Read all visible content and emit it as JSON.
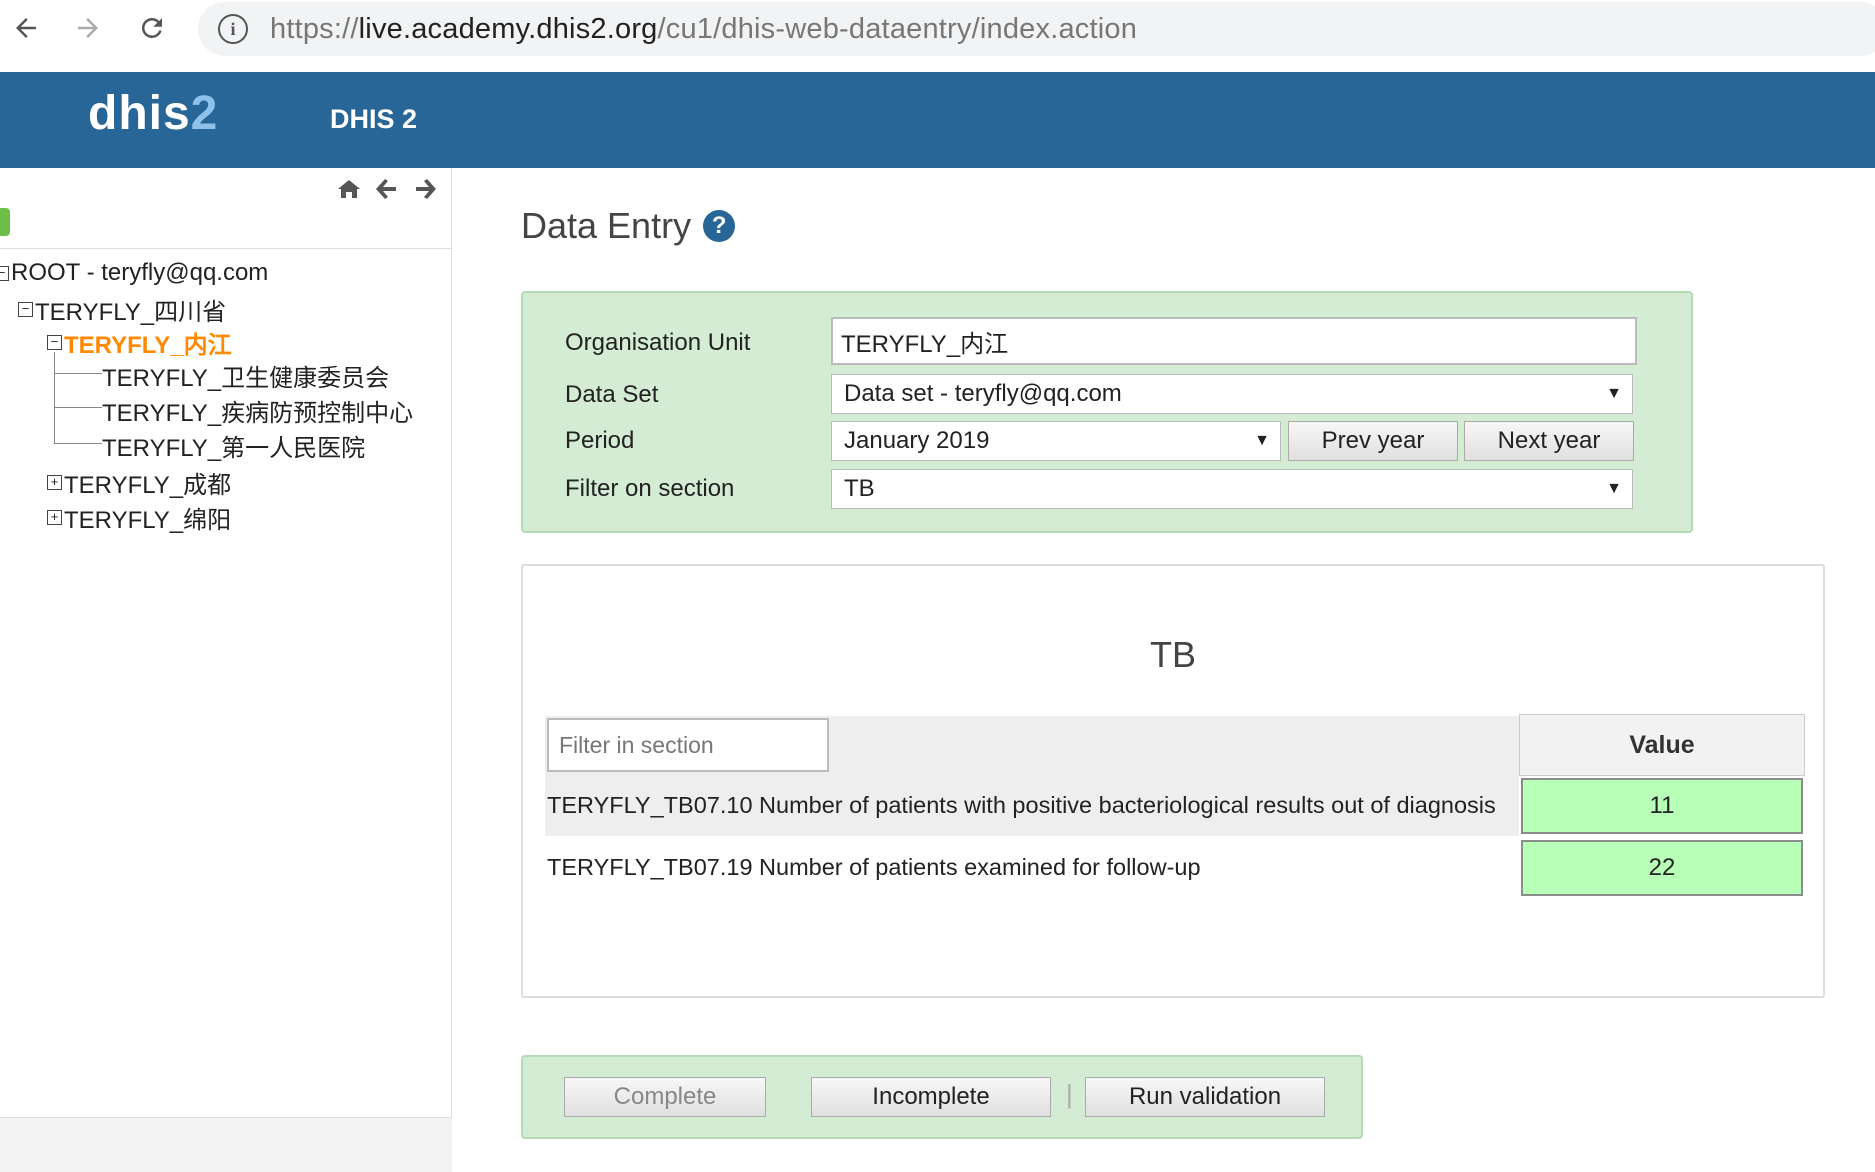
{
  "browser": {
    "url_scheme": "https://",
    "url_host": "live.academy.dhis2.org",
    "url_path": "/cu1/dhis-web-dataentry/index.action",
    "icons": [
      "back-arrow-icon",
      "forward-arrow-icon",
      "reload-icon",
      "info-icon"
    ]
  },
  "header": {
    "logo_main": "dhis",
    "logo_num": "2",
    "title": "DHIS 2",
    "color": "#276696"
  },
  "tree": {
    "root": "ROOT - teryfly@qq.com",
    "province": "TERYFLY_四川省",
    "selected": "TERYFLY_内江",
    "children": [
      "TERYFLY_卫生健康委员会",
      "TERYFLY_疾病防预控制中心",
      "TERYFLY_第一人民医院"
    ],
    "siblings": [
      "TERYFLY_成都",
      "TERYFLY_绵阳"
    ],
    "collapse_symbol": "−",
    "expand_symbol": "+"
  },
  "main": {
    "title": "Data Entry",
    "help_symbol": "?"
  },
  "form": {
    "org_unit_label": "Organisation Unit",
    "org_unit_value": "TERYFLY_内江",
    "data_set_label": "Data Set",
    "data_set_value": "Data set - teryfly@qq.com",
    "period_label": "Period",
    "period_value": "January 2019",
    "prev_year": "Prev year",
    "next_year": "Next year",
    "filter_label": "Filter on section",
    "filter_value": "TB",
    "caret": "▼"
  },
  "section": {
    "title": "TB",
    "filter_placeholder": "Filter in section",
    "value_header": "Value",
    "rows": [
      {
        "label": "TERYFLY_TB07.10 Number of patients with positive bacteriological results out of diagnosis",
        "value": "11"
      },
      {
        "label": "TERYFLY_TB07.19 Number of patients examined for follow-up",
        "value": "22"
      }
    ]
  },
  "actions": {
    "complete": "Complete",
    "incomplete": "Incomplete",
    "separator": "|",
    "run_validation": "Run validation"
  }
}
